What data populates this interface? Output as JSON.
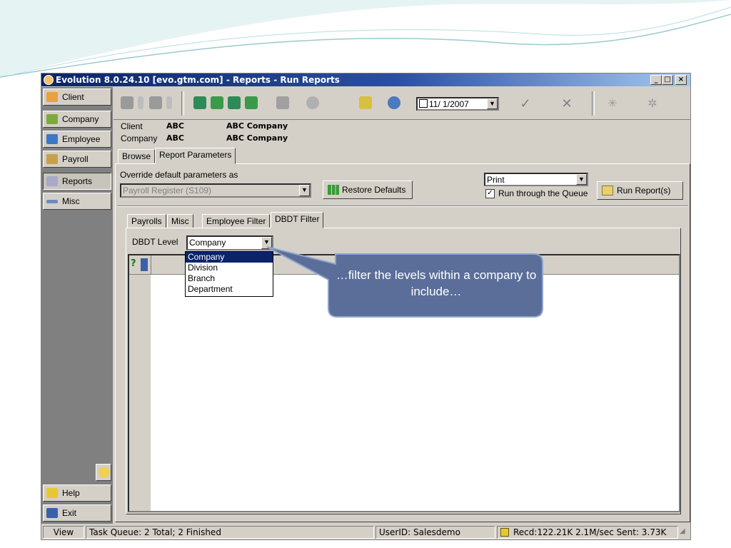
{
  "window": {
    "title": "Evolution 8.0.24.10 [evo.gtm.com] - Reports - Run Reports",
    "minimize_icon": "minimize-icon",
    "maximize_icon": "maximize-icon",
    "close_icon": "close-icon"
  },
  "sidebar": {
    "items": [
      {
        "label": "Client",
        "icon": "client-icon"
      },
      {
        "label": "Company",
        "icon": "company-icon"
      },
      {
        "label": "Employee",
        "icon": "employee-icon"
      },
      {
        "label": "Payroll",
        "icon": "payroll-icon"
      },
      {
        "label": "Reports",
        "icon": "reports-icon",
        "selected": true
      },
      {
        "label": "Misc",
        "icon": "misc-icon"
      }
    ],
    "help_label": "Help",
    "exit_label": "Exit"
  },
  "toolbar": {
    "date_value": "11/ 1/2007"
  },
  "info": {
    "client_label": "Client",
    "client_code": "ABC",
    "client_name": "ABC Company",
    "company_label": "Company",
    "company_code": "ABC",
    "company_name": "ABC Company"
  },
  "tabs": [
    "Browse",
    "Report Parameters"
  ],
  "params": {
    "override_label": "Override default parameters as",
    "override_value": "Payroll Register (S109)",
    "restore_defaults_label": "Restore Defaults",
    "output_value": "Print",
    "queue_checkbox_label": "Run through the Queue",
    "queue_checked": true,
    "run_reports_label": "Run Report(s)"
  },
  "subtabs": [
    "Payrolls",
    "Misc",
    "Employee Filter",
    "DBDT Filter"
  ],
  "dbdt": {
    "level_label": "DBDT Level",
    "level_value": "Company",
    "options": [
      "Company",
      "Division",
      "Branch",
      "Department"
    ]
  },
  "statusbar": {
    "view_label": "View",
    "task_queue": "Task Queue: 2 Total; 2 Finished",
    "user": "UserID: Salesdemo",
    "traffic": "Recd:122.21K  2.1M/sec  Sent: 3.73K"
  },
  "callout": {
    "text": "…filter the levels within a company to include…"
  },
  "colors": {
    "window_bg": "#d4d0c8",
    "title_start": "#0a246a",
    "callout_fill": "#5a6e99",
    "selection": "#0a246a"
  }
}
